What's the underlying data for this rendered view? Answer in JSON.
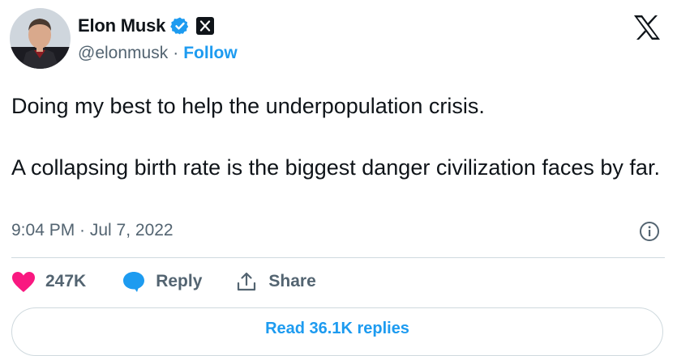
{
  "author": {
    "display_name": "Elon Musk",
    "handle": "@elonmusk",
    "separator": "·",
    "follow_label": "Follow"
  },
  "icons": {
    "verified": "verified-badge-icon",
    "affiliate": "x-badge-icon",
    "platform": "x-logo-icon",
    "info": "info-icon",
    "like": "heart-icon",
    "reply": "reply-bubble-icon",
    "share": "share-upload-icon"
  },
  "tweet": {
    "text": "Doing my best to help the underpopulation crisis.\n\nA collapsing birth rate is the biggest danger civilization faces by far.",
    "timestamp": "9:04 PM · Jul 7, 2022"
  },
  "actions": {
    "like_count": "247K",
    "reply_label": "Reply",
    "share_label": "Share"
  },
  "footer": {
    "read_replies_label": "Read 36.1K replies"
  },
  "colors": {
    "accent": "#1d9bf0",
    "like": "#f91880",
    "text": "#0f1419",
    "secondary_text": "#536471",
    "border": "#cfd9de"
  }
}
